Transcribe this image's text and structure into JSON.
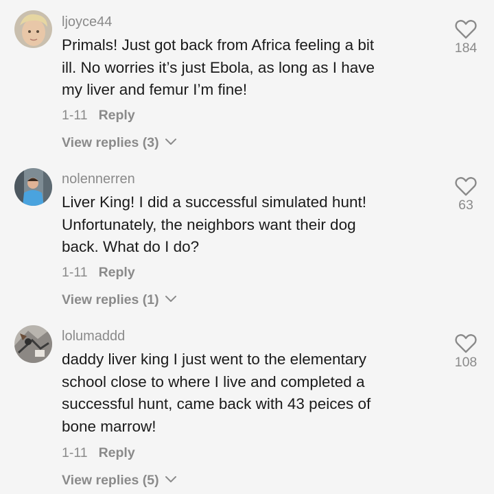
{
  "comments": [
    {
      "username": "ljoyce44",
      "lines": [
        "Primals! Just got back from Africa feeling a bit",
        "ill. No worries it’s just Ebola, as long as I have",
        "my liver and femur I’m fine!"
      ],
      "date": "1-11",
      "reply_label": "Reply",
      "view_replies_label": "View replies (3)",
      "likes": "184",
      "heart_icon": "heart-outline-icon",
      "chevron_icon": "chevron-down-icon"
    },
    {
      "username": "nolennerren",
      "lines": [
        "Liver King! I did a successful simulated hunt!",
        "Unfortunately, the neighbors want their dog",
        "back. What do I do?"
      ],
      "date": "1-11",
      "reply_label": "Reply",
      "view_replies_label": "View replies (1)",
      "likes": "63",
      "heart_icon": "heart-outline-icon",
      "chevron_icon": "chevron-down-icon"
    },
    {
      "username": "lolumaddd",
      "lines": [
        "daddy liver king I just went to the elementary",
        "school close to where I live and completed a",
        "successful hunt, came back with 43 peices of",
        "bone marrow!"
      ],
      "date": "1-11",
      "reply_label": "Reply",
      "view_replies_label": "View replies (5)",
      "likes": "108",
      "heart_icon": "heart-outline-icon",
      "chevron_icon": "chevron-down-icon"
    }
  ],
  "colors": {
    "background": "#f5f5f5",
    "primary_text": "#1a1a1a",
    "secondary_text": "#8a8a8a"
  }
}
